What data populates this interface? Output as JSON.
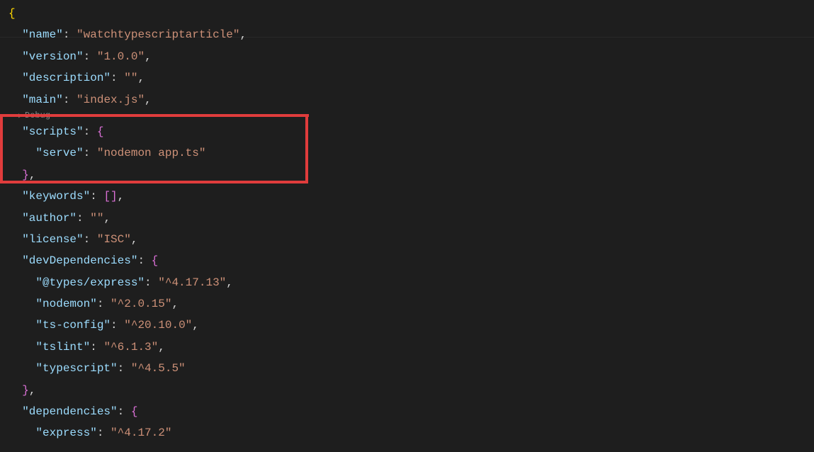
{
  "code": {
    "brace_open": "{",
    "brace_close": "}",
    "bracket_open": "[",
    "bracket_close": "]",
    "colon": ":",
    "comma": ",",
    "empty_string": "\"\"",
    "fields": {
      "name_key": "\"name\"",
      "name_val": "\"watchtypescriptarticle\"",
      "version_key": "\"version\"",
      "version_val": "\"1.0.0\"",
      "description_key": "\"description\"",
      "main_key": "\"main\"",
      "main_val": "\"index.js\"",
      "scripts_key": "\"scripts\"",
      "serve_key": "\"serve\"",
      "serve_val": "\"nodemon app.ts\"",
      "keywords_key": "\"keywords\"",
      "author_key": "\"author\"",
      "license_key": "\"license\"",
      "license_val": "\"ISC\"",
      "devDependencies_key": "\"devDependencies\"",
      "types_express_key": "\"@types/express\"",
      "types_express_val": "\"^4.17.13\"",
      "nodemon_key": "\"nodemon\"",
      "nodemon_val": "\"^2.0.15\"",
      "tsconfig_key": "\"ts-config\"",
      "tsconfig_val": "\"^20.10.0\"",
      "tslint_key": "\"tslint\"",
      "tslint_val": "\"^6.1.3\"",
      "typescript_key": "\"typescript\"",
      "typescript_val": "\"^4.5.5\"",
      "dependencies_key": "\"dependencies\"",
      "express_key": "\"express\"",
      "express_val": "\"^4.17.2\""
    },
    "debug_hint": "Debug",
    "debug_icon": "▷"
  }
}
